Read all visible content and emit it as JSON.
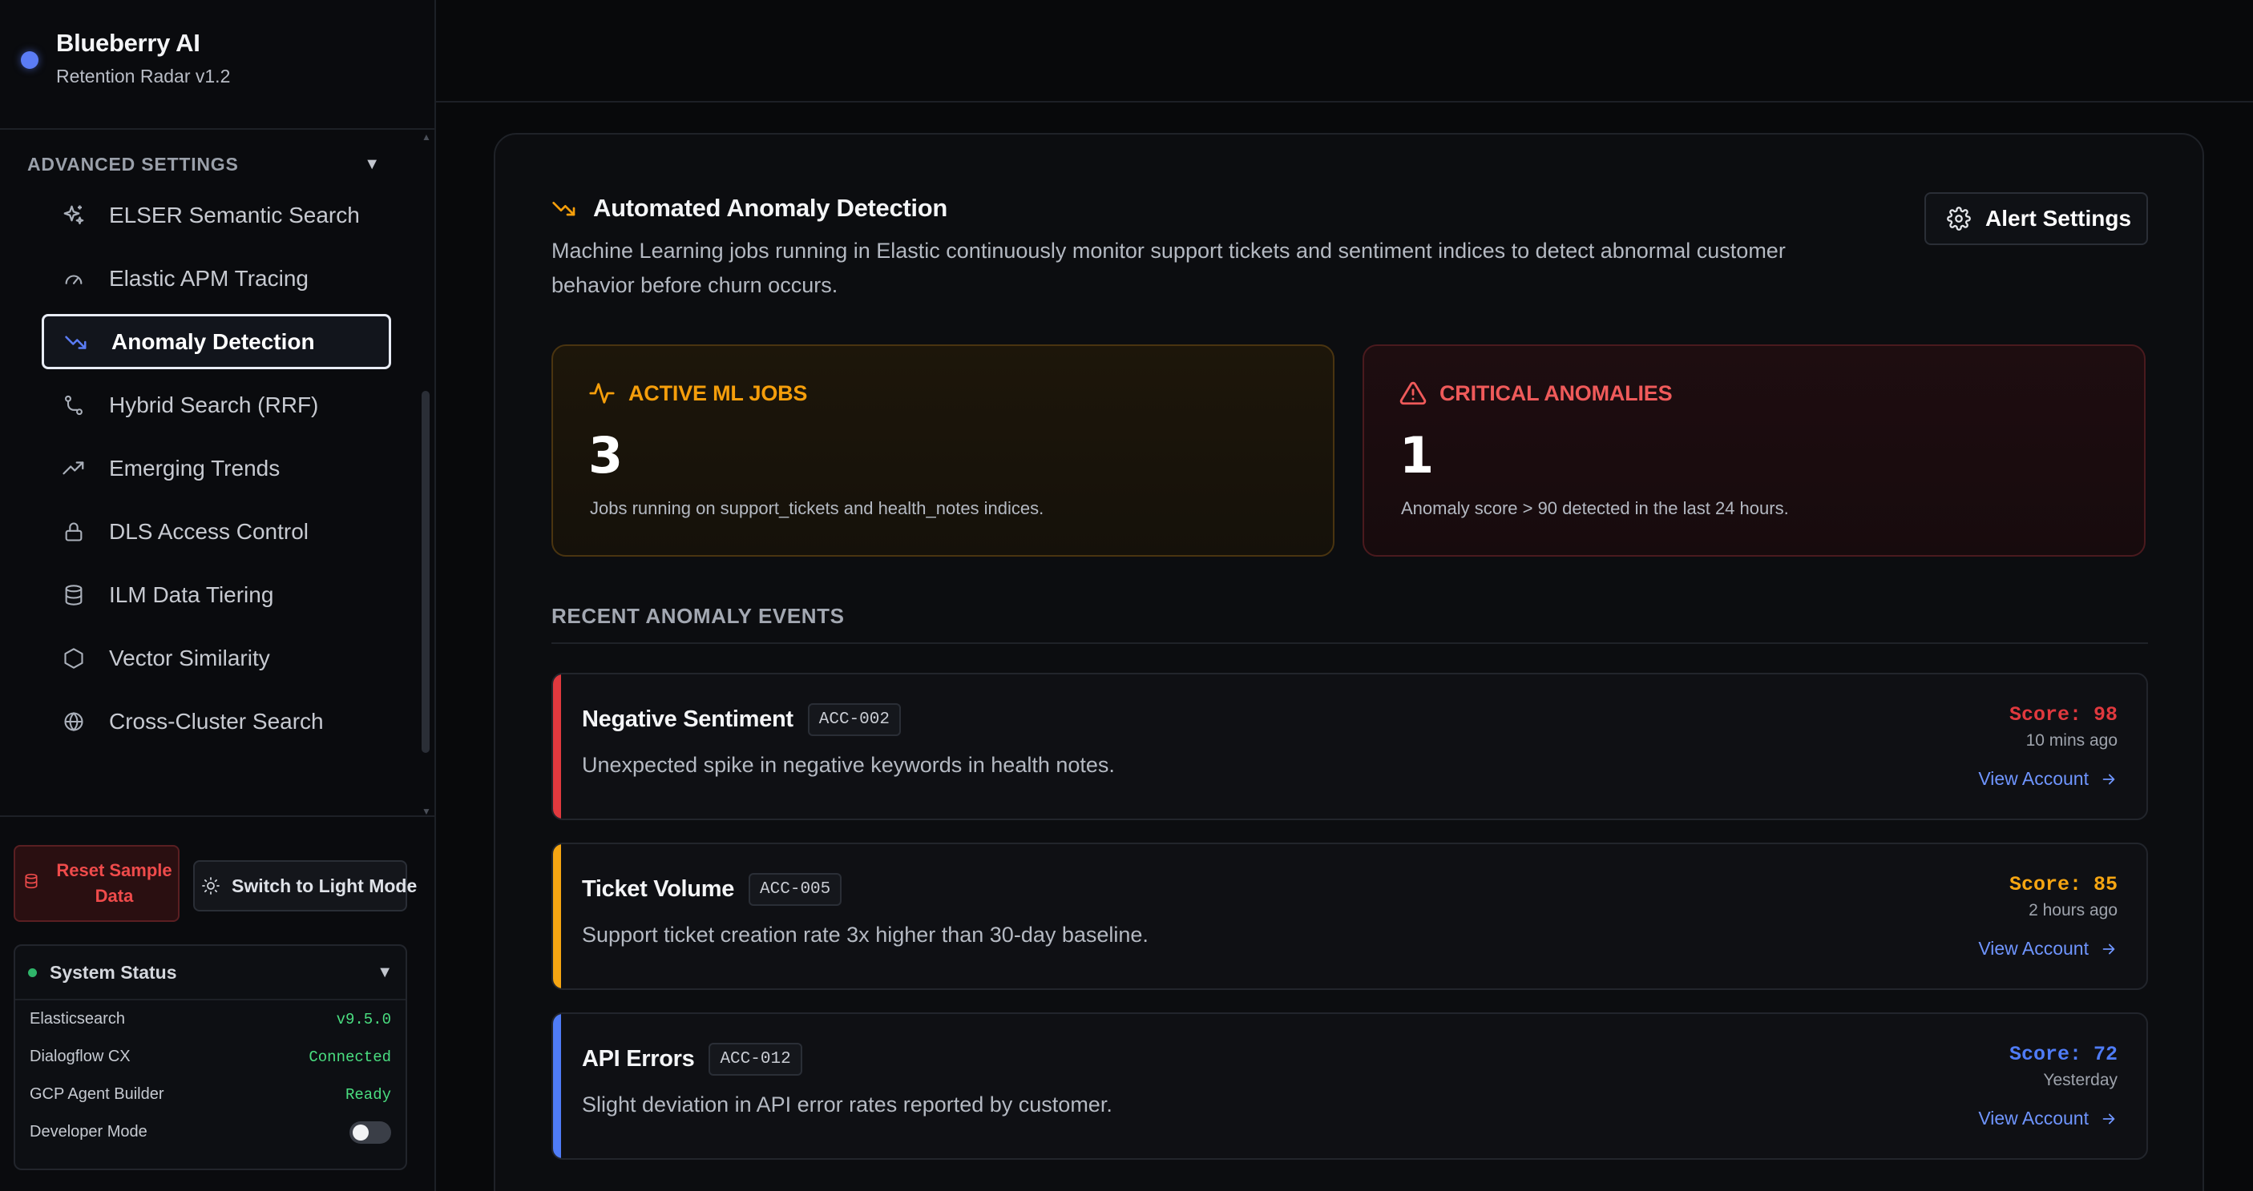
{
  "brand": {
    "name": "Blueberry AI",
    "subtitle": "Retention Radar v1.2"
  },
  "sidebar": {
    "section_title": "ADVANCED SETTINGS",
    "items": [
      {
        "label": "ELSER Semantic Search",
        "icon": "sparkles-icon"
      },
      {
        "label": "Elastic APM Tracing",
        "icon": "gauge-icon"
      },
      {
        "label": "Anomaly Detection",
        "icon": "trending-down-icon",
        "active": true
      },
      {
        "label": "Hybrid Search (RRF)",
        "icon": "git-branch-icon"
      },
      {
        "label": "Emerging Trends",
        "icon": "trending-up-icon"
      },
      {
        "label": "DLS Access Control",
        "icon": "lock-icon"
      },
      {
        "label": "ILM Data Tiering",
        "icon": "database-icon"
      },
      {
        "label": "Vector Similarity",
        "icon": "hexagon-icon"
      },
      {
        "label": "Cross-Cluster Search",
        "icon": "globe-icon"
      }
    ],
    "reset_label": "Reset Sample Data",
    "theme_label": "Switch to Light Mode"
  },
  "status": {
    "title": "System Status",
    "rows": [
      {
        "label": "Elasticsearch",
        "value": "v9.5.0"
      },
      {
        "label": "Dialogflow CX",
        "value": "Connected"
      },
      {
        "label": "GCP Agent Builder",
        "value": "Ready"
      },
      {
        "label": "Developer Mode",
        "toggle": false
      }
    ]
  },
  "main": {
    "title": "Automated Anomaly Detection",
    "description": "Machine Learning jobs running in Elastic continuously monitor support tickets and sentiment indices to detect abnormal customer behavior before churn occurs.",
    "alert_button": "Alert Settings",
    "stats": {
      "jobs": {
        "label": "ACTIVE ML JOBS",
        "value": "3",
        "sub": "Jobs running on support_tickets and health_notes indices."
      },
      "critical": {
        "label": "CRITICAL ANOMALIES",
        "value": "1",
        "sub": "Anomaly score > 90 detected in the last 24 hours."
      }
    },
    "events_title": "RECENT ANOMALY EVENTS",
    "events": [
      {
        "title": "Negative Sentiment",
        "account": "ACC-002",
        "desc": "Unexpected spike in negative keywords in health notes.",
        "score": "Score: 98",
        "time": "10 mins ago",
        "link": "View Account",
        "color": "#e0393e"
      },
      {
        "title": "Ticket Volume",
        "account": "ACC-005",
        "desc": "Support ticket creation rate 3x higher than 30-day baseline.",
        "score": "Score: 85",
        "time": "2 hours ago",
        "link": "View Account",
        "color": "#f5a512"
      },
      {
        "title": "API Errors",
        "account": "ACC-012",
        "desc": "Slight deviation in API error rates reported by customer.",
        "score": "Score: 72",
        "time": "Yesterday",
        "link": "View Account",
        "color": "#4f7cf7"
      }
    ]
  },
  "colors": {
    "accent": "#5b7cf5",
    "warning": "#f59e0b",
    "danger": "#ef5a5a",
    "link": "#6f95ff",
    "success": "#4ade80"
  }
}
